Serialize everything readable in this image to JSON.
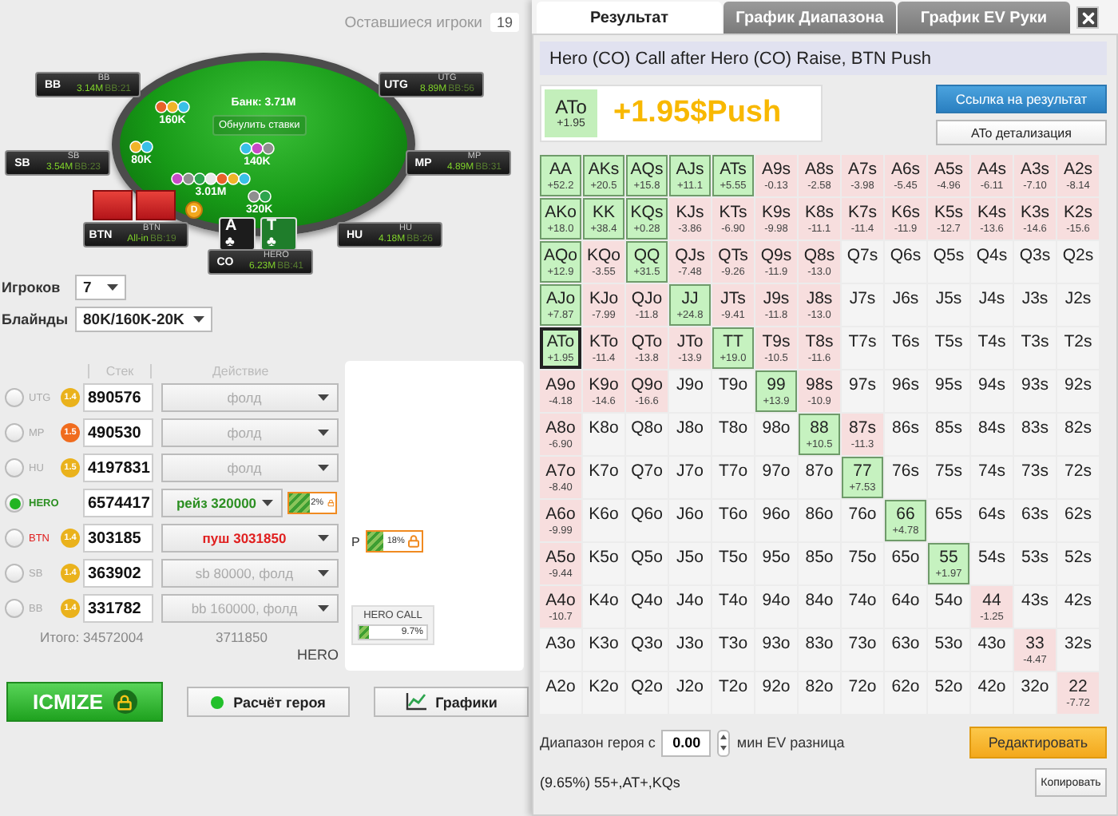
{
  "remaining_players": {
    "label": "Оставшиеся игроки",
    "count": "19"
  },
  "table": {
    "pot": "Банк: 3.71M",
    "reset_button": "Обнулить ставки",
    "dealer": "D",
    "seats": [
      {
        "position": "BB",
        "name": "BB",
        "stack": "3.14M",
        "bb": "BB:21"
      },
      {
        "position": "UTG",
        "name": "UTG",
        "stack": "8.89M",
        "bb": "BB:56"
      },
      {
        "position": "SB",
        "name": "SB",
        "stack": "3.54M",
        "bb": "BB:23"
      },
      {
        "position": "MP",
        "name": "MP",
        "stack": "4.89M",
        "bb": "BB:31"
      },
      {
        "position": "BTN",
        "name": "BTN",
        "stack": "All-in",
        "bb": "BB:19"
      },
      {
        "position": "HU",
        "name": "HU",
        "stack": "4.18M",
        "bb": "BB:26"
      },
      {
        "position": "CO",
        "name": "HERO",
        "stack": "6.23M",
        "bb": "BB:41"
      }
    ],
    "bets": [
      {
        "amount": "160K"
      },
      {
        "amount": "80K"
      },
      {
        "amount": "140K"
      },
      {
        "amount": "3.01M"
      },
      {
        "amount": "320K"
      }
    ],
    "hero_cards": [
      {
        "rank": "A",
        "suit": "♣",
        "color": "#1c1c1c"
      },
      {
        "rank": "T",
        "suit": "♣",
        "color": "#1f7d2b"
      }
    ]
  },
  "settings": [
    {
      "label": "Игроков",
      "value": "7"
    },
    {
      "label": "Блайнды",
      "value": "80K/160K-20K"
    }
  ],
  "players": {
    "headers": [
      "Стек",
      "Действие"
    ],
    "rows": [
      {
        "position": "UTG",
        "selected": false,
        "icm": "1.4",
        "color": "#eab21c",
        "stack": "890576",
        "action": "фолд",
        "kind": "fold"
      },
      {
        "position": "MP",
        "selected": false,
        "icm": "1.5",
        "color": "#f06c1e",
        "stack": "490530",
        "action": "фолд",
        "kind": "fold"
      },
      {
        "position": "HU",
        "selected": false,
        "icm": "1.5",
        "color": "#eab21c",
        "stack": "4197831",
        "action": "фолд",
        "kind": "fold"
      },
      {
        "position": "HERO",
        "selected": true,
        "stack": "6574417",
        "action": "рейз 320000",
        "kind": "raise",
        "lock": {
          "text": "2%",
          "level": 0.45
        }
      },
      {
        "position": "BTN",
        "selected": false,
        "icm": "1.4",
        "color": "#eab21c",
        "stack": "303185",
        "action": "пуш 3031850",
        "kind": "push"
      },
      {
        "position": "SB",
        "selected": false,
        "icm": "1.4",
        "color": "#eab21c",
        "stack": "363902",
        "action": "sb 80000, фолд",
        "kind": "fold"
      },
      {
        "position": "BB",
        "selected": false,
        "icm": "1.4",
        "color": "#eab21c",
        "stack": "331782",
        "action": "bb 160000, фолд",
        "kind": "fold"
      }
    ],
    "total_stack": "Итого: 34572004",
    "total_action": "3711850",
    "hero_label": "HERO"
  },
  "side_panel": {
    "range_bar": {
      "label": "P",
      "text": "18%",
      "level": 0.3
    },
    "hero_call": {
      "title": "HERO CALL",
      "text": "9.7%",
      "level": 0.15
    }
  },
  "buttons": {
    "icmize": "ICMIZE",
    "hero_calc": "Расчёт героя",
    "charts": "Графики"
  },
  "result": {
    "tabs": [
      {
        "label": "Результат",
        "selected": true
      },
      {
        "label": "График Диапазона",
        "selected": false
      },
      {
        "label": "График EV Руки",
        "selected": false
      }
    ],
    "title": "Hero (CO) Call after Hero (CO) Raise, BTN Push",
    "summary": {
      "hand": "ATo",
      "ev": "+1.95",
      "result": "+1.95$Push"
    },
    "link_button": "Ссылка на результат",
    "detail_button": "ATo детализация",
    "grid": [
      [
        {
          "hand": "AA",
          "ev": "+52.2",
          "kind": "plus",
          "selected": false
        },
        {
          "hand": "AKs",
          "ev": "+20.5",
          "kind": "plus",
          "selected": false
        },
        {
          "hand": "AQs",
          "ev": "+15.8",
          "kind": "plus",
          "selected": false
        },
        {
          "hand": "AJs",
          "ev": "+11.1",
          "kind": "plus",
          "selected": false
        },
        {
          "hand": "ATs",
          "ev": "+5.55",
          "kind": "plus",
          "selected": false
        },
        {
          "hand": "A9s",
          "ev": "-0.13",
          "kind": "minus",
          "selected": false
        },
        {
          "hand": "A8s",
          "ev": "-2.58",
          "kind": "minus",
          "selected": false
        },
        {
          "hand": "A7s",
          "ev": "-3.98",
          "kind": "minus",
          "selected": false
        },
        {
          "hand": "A6s",
          "ev": "-5.45",
          "kind": "minus",
          "selected": false
        },
        {
          "hand": "A5s",
          "ev": "-4.96",
          "kind": "minus",
          "selected": false
        },
        {
          "hand": "A4s",
          "ev": "-6.11",
          "kind": "minus",
          "selected": false
        },
        {
          "hand": "A3s",
          "ev": "-7.10",
          "kind": "minus",
          "selected": false
        },
        {
          "hand": "A2s",
          "ev": "-8.14",
          "kind": "minus",
          "selected": false
        }
      ],
      [
        {
          "hand": "AKo",
          "ev": "+18.0",
          "kind": "plus",
          "selected": false
        },
        {
          "hand": "KK",
          "ev": "+38.4",
          "kind": "plus",
          "selected": false
        },
        {
          "hand": "KQs",
          "ev": "+0.28",
          "kind": "plus",
          "selected": false
        },
        {
          "hand": "KJs",
          "ev": "-3.86",
          "kind": "minus",
          "selected": false
        },
        {
          "hand": "KTs",
          "ev": "-6.90",
          "kind": "minus",
          "selected": false
        },
        {
          "hand": "K9s",
          "ev": "-9.98",
          "kind": "minus",
          "selected": false
        },
        {
          "hand": "K8s",
          "ev": "-11.1",
          "kind": "minus",
          "selected": false
        },
        {
          "hand": "K7s",
          "ev": "-11.4",
          "kind": "minus",
          "selected": false
        },
        {
          "hand": "K6s",
          "ev": "-11.9",
          "kind": "minus",
          "selected": false
        },
        {
          "hand": "K5s",
          "ev": "-12.7",
          "kind": "minus",
          "selected": false
        },
        {
          "hand": "K4s",
          "ev": "-13.6",
          "kind": "minus",
          "selected": false
        },
        {
          "hand": "K3s",
          "ev": "-14.6",
          "kind": "minus",
          "selected": false
        },
        {
          "hand": "K2s",
          "ev": "-15.6",
          "kind": "minus",
          "selected": false
        }
      ],
      [
        {
          "hand": "AQo",
          "ev": "+12.9",
          "kind": "plus",
          "selected": false
        },
        {
          "hand": "KQo",
          "ev": "-3.55",
          "kind": "minus",
          "selected": false
        },
        {
          "hand": "QQ",
          "ev": "+31.5",
          "kind": "plus",
          "selected": false
        },
        {
          "hand": "QJs",
          "ev": "-7.48",
          "kind": "minus",
          "selected": false
        },
        {
          "hand": "QTs",
          "ev": "-9.26",
          "kind": "minus",
          "selected": false
        },
        {
          "hand": "Q9s",
          "ev": "-11.9",
          "kind": "minus",
          "selected": false
        },
        {
          "hand": "Q8s",
          "ev": "-13.0",
          "kind": "minus",
          "selected": false
        },
        {
          "hand": "Q7s",
          "kind": "none",
          "selected": false
        },
        {
          "hand": "Q6s",
          "kind": "none",
          "selected": false
        },
        {
          "hand": "Q5s",
          "kind": "none",
          "selected": false
        },
        {
          "hand": "Q4s",
          "kind": "none",
          "selected": false
        },
        {
          "hand": "Q3s",
          "kind": "none",
          "selected": false
        },
        {
          "hand": "Q2s",
          "kind": "none",
          "selected": false
        }
      ],
      [
        {
          "hand": "AJo",
          "ev": "+7.87",
          "kind": "plus",
          "selected": false
        },
        {
          "hand": "KJo",
          "ev": "-7.99",
          "kind": "minus",
          "selected": false
        },
        {
          "hand": "QJo",
          "ev": "-11.8",
          "kind": "minus",
          "selected": false
        },
        {
          "hand": "JJ",
          "ev": "+24.8",
          "kind": "plus",
          "selected": false
        },
        {
          "hand": "JTs",
          "ev": "-9.41",
          "kind": "minus",
          "selected": false
        },
        {
          "hand": "J9s",
          "ev": "-11.8",
          "kind": "minus",
          "selected": false
        },
        {
          "hand": "J8s",
          "ev": "-13.0",
          "kind": "minus",
          "selected": false
        },
        {
          "hand": "J7s",
          "kind": "none",
          "selected": false
        },
        {
          "hand": "J6s",
          "kind": "none",
          "selected": false
        },
        {
          "hand": "J5s",
          "kind": "none",
          "selected": false
        },
        {
          "hand": "J4s",
          "kind": "none",
          "selected": false
        },
        {
          "hand": "J3s",
          "kind": "none",
          "selected": false
        },
        {
          "hand": "J2s",
          "kind": "none",
          "selected": false
        }
      ],
      [
        {
          "hand": "ATo",
          "ev": "+1.95",
          "kind": "plus",
          "selected": true
        },
        {
          "hand": "KTo",
          "ev": "-11.4",
          "kind": "minus",
          "selected": false
        },
        {
          "hand": "QTo",
          "ev": "-13.8",
          "kind": "minus",
          "selected": false
        },
        {
          "hand": "JTo",
          "ev": "-13.9",
          "kind": "minus",
          "selected": false
        },
        {
          "hand": "TT",
          "ev": "+19.0",
          "kind": "plus",
          "selected": false
        },
        {
          "hand": "T9s",
          "ev": "-10.5",
          "kind": "minus",
          "selected": false
        },
        {
          "hand": "T8s",
          "ev": "-11.6",
          "kind": "minus",
          "selected": false
        },
        {
          "hand": "T7s",
          "kind": "none",
          "selected": false
        },
        {
          "hand": "T6s",
          "kind": "none",
          "selected": false
        },
        {
          "hand": "T5s",
          "kind": "none",
          "selected": false
        },
        {
          "hand": "T4s",
          "kind": "none",
          "selected": false
        },
        {
          "hand": "T3s",
          "kind": "none",
          "selected": false
        },
        {
          "hand": "T2s",
          "kind": "none",
          "selected": false
        }
      ],
      [
        {
          "hand": "A9o",
          "ev": "-4.18",
          "kind": "minus",
          "selected": false
        },
        {
          "hand": "K9o",
          "ev": "-14.6",
          "kind": "minus",
          "selected": false
        },
        {
          "hand": "Q9o",
          "ev": "-16.6",
          "kind": "minus",
          "selected": false
        },
        {
          "hand": "J9o",
          "kind": "none",
          "selected": false
        },
        {
          "hand": "T9o",
          "kind": "none",
          "selected": false
        },
        {
          "hand": "99",
          "ev": "+13.9",
          "kind": "plus",
          "selected": false
        },
        {
          "hand": "98s",
          "ev": "-10.9",
          "kind": "minus",
          "selected": false
        },
        {
          "hand": "97s",
          "kind": "none",
          "selected": false
        },
        {
          "hand": "96s",
          "kind": "none",
          "selected": false
        },
        {
          "hand": "95s",
          "kind": "none",
          "selected": false
        },
        {
          "hand": "94s",
          "kind": "none",
          "selected": false
        },
        {
          "hand": "93s",
          "kind": "none",
          "selected": false
        },
        {
          "hand": "92s",
          "kind": "none",
          "selected": false
        }
      ],
      [
        {
          "hand": "A8o",
          "ev": "-6.90",
          "kind": "minus",
          "selected": false
        },
        {
          "hand": "K8o",
          "kind": "none",
          "selected": false
        },
        {
          "hand": "Q8o",
          "kind": "none",
          "selected": false
        },
        {
          "hand": "J8o",
          "kind": "none",
          "selected": false
        },
        {
          "hand": "T8o",
          "kind": "none",
          "selected": false
        },
        {
          "hand": "98o",
          "kind": "none",
          "selected": false
        },
        {
          "hand": "88",
          "ev": "+10.5",
          "kind": "plus",
          "selected": false
        },
        {
          "hand": "87s",
          "ev": "-11.3",
          "kind": "minus",
          "selected": false
        },
        {
          "hand": "86s",
          "kind": "none",
          "selected": false
        },
        {
          "hand": "85s",
          "kind": "none",
          "selected": false
        },
        {
          "hand": "84s",
          "kind": "none",
          "selected": false
        },
        {
          "hand": "83s",
          "kind": "none",
          "selected": false
        },
        {
          "hand": "82s",
          "kind": "none",
          "selected": false
        }
      ],
      [
        {
          "hand": "A7o",
          "ev": "-8.40",
          "kind": "minus",
          "selected": false
        },
        {
          "hand": "K7o",
          "kind": "none",
          "selected": false
        },
        {
          "hand": "Q7o",
          "kind": "none",
          "selected": false
        },
        {
          "hand": "J7o",
          "kind": "none",
          "selected": false
        },
        {
          "hand": "T7o",
          "kind": "none",
          "selected": false
        },
        {
          "hand": "97o",
          "kind": "none",
          "selected": false
        },
        {
          "hand": "87o",
          "kind": "none",
          "selected": false
        },
        {
          "hand": "77",
          "ev": "+7.53",
          "kind": "plus",
          "selected": false
        },
        {
          "hand": "76s",
          "kind": "none",
          "selected": false
        },
        {
          "hand": "75s",
          "kind": "none",
          "selected": false
        },
        {
          "hand": "74s",
          "kind": "none",
          "selected": false
        },
        {
          "hand": "73s",
          "kind": "none",
          "selected": false
        },
        {
          "hand": "72s",
          "kind": "none",
          "selected": false
        }
      ],
      [
        {
          "hand": "A6o",
          "ev": "-9.99",
          "kind": "minus",
          "selected": false
        },
        {
          "hand": "K6o",
          "kind": "none",
          "selected": false
        },
        {
          "hand": "Q6o",
          "kind": "none",
          "selected": false
        },
        {
          "hand": "J6o",
          "kind": "none",
          "selected": false
        },
        {
          "hand": "T6o",
          "kind": "none",
          "selected": false
        },
        {
          "hand": "96o",
          "kind": "none",
          "selected": false
        },
        {
          "hand": "86o",
          "kind": "none",
          "selected": false
        },
        {
          "hand": "76o",
          "kind": "none",
          "selected": false
        },
        {
          "hand": "66",
          "ev": "+4.78",
          "kind": "plus",
          "selected": false
        },
        {
          "hand": "65s",
          "kind": "none",
          "selected": false
        },
        {
          "hand": "64s",
          "kind": "none",
          "selected": false
        },
        {
          "hand": "63s",
          "kind": "none",
          "selected": false
        },
        {
          "hand": "62s",
          "kind": "none",
          "selected": false
        }
      ],
      [
        {
          "hand": "A5o",
          "ev": "-9.44",
          "kind": "minus",
          "selected": false
        },
        {
          "hand": "K5o",
          "kind": "none",
          "selected": false
        },
        {
          "hand": "Q5o",
          "kind": "none",
          "selected": false
        },
        {
          "hand": "J5o",
          "kind": "none",
          "selected": false
        },
        {
          "hand": "T5o",
          "kind": "none",
          "selected": false
        },
        {
          "hand": "95o",
          "kind": "none",
          "selected": false
        },
        {
          "hand": "85o",
          "kind": "none",
          "selected": false
        },
        {
          "hand": "75o",
          "kind": "none",
          "selected": false
        },
        {
          "hand": "65o",
          "kind": "none",
          "selected": false
        },
        {
          "hand": "55",
          "ev": "+1.97",
          "kind": "plus",
          "selected": false
        },
        {
          "hand": "54s",
          "kind": "none",
          "selected": false
        },
        {
          "hand": "53s",
          "kind": "none",
          "selected": false
        },
        {
          "hand": "52s",
          "kind": "none",
          "selected": false
        }
      ],
      [
        {
          "hand": "A4o",
          "ev": "-10.7",
          "kind": "minus",
          "selected": false
        },
        {
          "hand": "K4o",
          "kind": "none",
          "selected": false
        },
        {
          "hand": "Q4o",
          "kind": "none",
          "selected": false
        },
        {
          "hand": "J4o",
          "kind": "none",
          "selected": false
        },
        {
          "hand": "T4o",
          "kind": "none",
          "selected": false
        },
        {
          "hand": "94o",
          "kind": "none",
          "selected": false
        },
        {
          "hand": "84o",
          "kind": "none",
          "selected": false
        },
        {
          "hand": "74o",
          "kind": "none",
          "selected": false
        },
        {
          "hand": "64o",
          "kind": "none",
          "selected": false
        },
        {
          "hand": "54o",
          "kind": "none",
          "selected": false
        },
        {
          "hand": "44",
          "ev": "-1.25",
          "kind": "minus",
          "selected": false
        },
        {
          "hand": "43s",
          "kind": "none",
          "selected": false
        },
        {
          "hand": "42s",
          "kind": "none",
          "selected": false
        }
      ],
      [
        {
          "hand": "A3o",
          "kind": "none",
          "selected": false
        },
        {
          "hand": "K3o",
          "kind": "none",
          "selected": false
        },
        {
          "hand": "Q3o",
          "kind": "none",
          "selected": false
        },
        {
          "hand": "J3o",
          "kind": "none",
          "selected": false
        },
        {
          "hand": "T3o",
          "kind": "none",
          "selected": false
        },
        {
          "hand": "93o",
          "kind": "none",
          "selected": false
        },
        {
          "hand": "83o",
          "kind": "none",
          "selected": false
        },
        {
          "hand": "73o",
          "kind": "none",
          "selected": false
        },
        {
          "hand": "63o",
          "kind": "none",
          "selected": false
        },
        {
          "hand": "53o",
          "kind": "none",
          "selected": false
        },
        {
          "hand": "43o",
          "kind": "none",
          "selected": false
        },
        {
          "hand": "33",
          "ev": "-4.47",
          "kind": "minus",
          "selected": false
        },
        {
          "hand": "32s",
          "kind": "none",
          "selected": false
        }
      ],
      [
        {
          "hand": "A2o",
          "kind": "none",
          "selected": false
        },
        {
          "hand": "K2o",
          "kind": "none",
          "selected": false
        },
        {
          "hand": "Q2o",
          "kind": "none",
          "selected": false
        },
        {
          "hand": "J2o",
          "kind": "none",
          "selected": false
        },
        {
          "hand": "T2o",
          "kind": "none",
          "selected": false
        },
        {
          "hand": "92o",
          "kind": "none",
          "selected": false
        },
        {
          "hand": "82o",
          "kind": "none",
          "selected": false
        },
        {
          "hand": "72o",
          "kind": "none",
          "selected": false
        },
        {
          "hand": "62o",
          "kind": "none",
          "selected": false
        },
        {
          "hand": "52o",
          "kind": "none",
          "selected": false
        },
        {
          "hand": "42o",
          "kind": "none",
          "selected": false
        },
        {
          "hand": "32o",
          "kind": "none",
          "selected": false
        },
        {
          "hand": "22",
          "ev": "-7.72",
          "kind": "minus",
          "selected": false
        }
      ]
    ],
    "footer": {
      "range_label": "Диапазон героя с",
      "min_ev": "0.00",
      "ev_label": "мин EV разница",
      "edit_button": "Редактировать",
      "range_text": "(9.65%) 55+,AT+,KQs",
      "copy_button": "Копировать"
    }
  }
}
